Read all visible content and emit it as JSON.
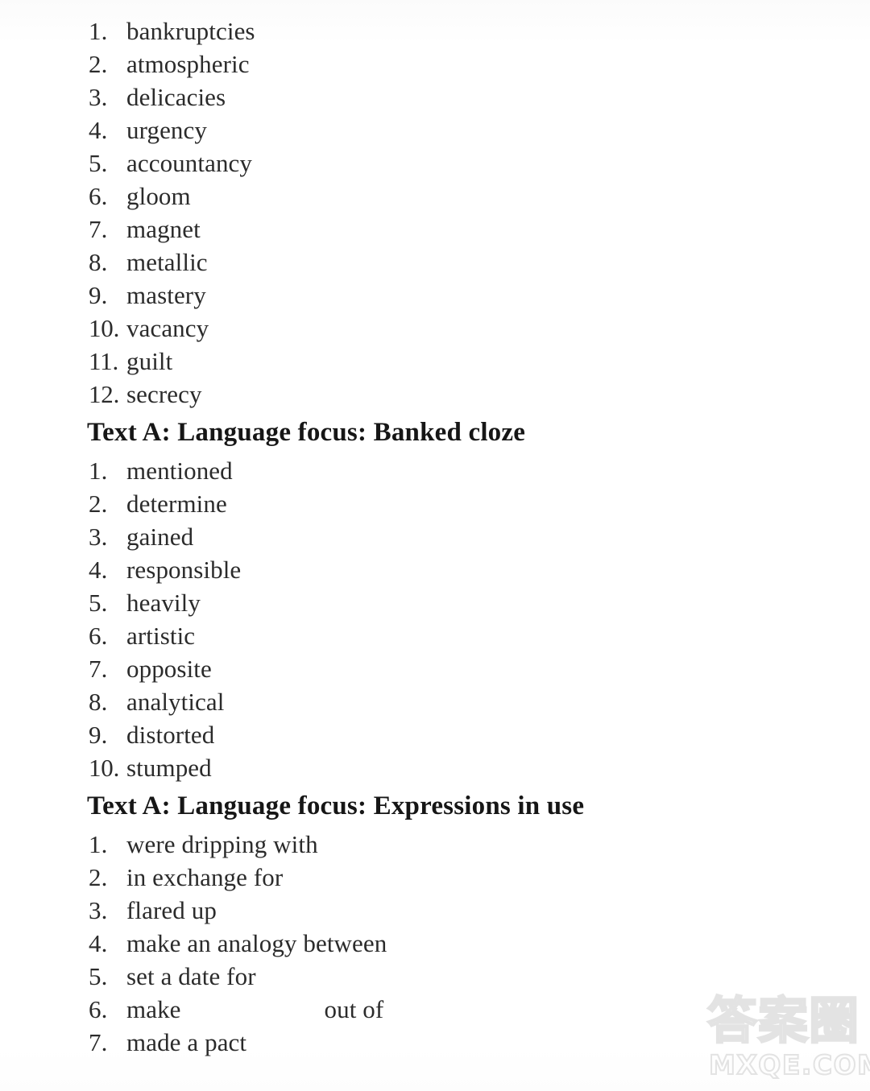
{
  "page": {
    "background_color": "#ffffff",
    "text_color": "#2b2b2b",
    "heading_color": "#161616"
  },
  "sections": [
    {
      "id": "word-formation-answers",
      "heading": null,
      "items": [
        {
          "num": "1.",
          "text": "bankruptcies"
        },
        {
          "num": "2.",
          "text": "atmospheric"
        },
        {
          "num": "3.",
          "text": "delicacies"
        },
        {
          "num": "4.",
          "text": "urgency"
        },
        {
          "num": "5.",
          "text": "accountancy"
        },
        {
          "num": "6.",
          "text": "gloom"
        },
        {
          "num": "7.",
          "text": "magnet"
        },
        {
          "num": "8.",
          "text": "metallic"
        },
        {
          "num": "9.",
          "text": "mastery"
        },
        {
          "num": "10.",
          "text": "vacancy"
        },
        {
          "num": "11.",
          "text": "guilt"
        },
        {
          "num": "12.",
          "text": "secrecy"
        }
      ]
    },
    {
      "id": "banked-cloze",
      "heading": "Text A: Language focus: Banked cloze",
      "items": [
        {
          "num": "1.",
          "text": "mentioned"
        },
        {
          "num": "2.",
          "text": "determine"
        },
        {
          "num": "3.",
          "text": "gained"
        },
        {
          "num": "4.",
          "text": "responsible"
        },
        {
          "num": "5.",
          "text": "heavily"
        },
        {
          "num": "6.",
          "text": "artistic"
        },
        {
          "num": "7.",
          "text": "opposite"
        },
        {
          "num": "8.",
          "text": "analytical"
        },
        {
          "num": "9.",
          "text": "distorted"
        },
        {
          "num": "10.",
          "text": "stumped"
        }
      ]
    },
    {
      "id": "expressions-in-use",
      "heading": "Text A: Language focus: Expressions in use",
      "items": [
        {
          "num": "1.",
          "text": "were dripping with"
        },
        {
          "num": "2.",
          "text": "in exchange for"
        },
        {
          "num": "3.",
          "text": "flared up"
        },
        {
          "num": "4.",
          "text": "make an analogy between"
        },
        {
          "num": "5.",
          "text": "set a date for"
        },
        {
          "num": "6.",
          "text_before_gap": "make",
          "text_after_gap": "out of"
        },
        {
          "num": "7.",
          "text": "made a pact"
        }
      ]
    }
  ],
  "watermark": {
    "cjk_text": "答案圈",
    "domain_text": "MXQE.COM",
    "color": "#e3e3e3"
  }
}
